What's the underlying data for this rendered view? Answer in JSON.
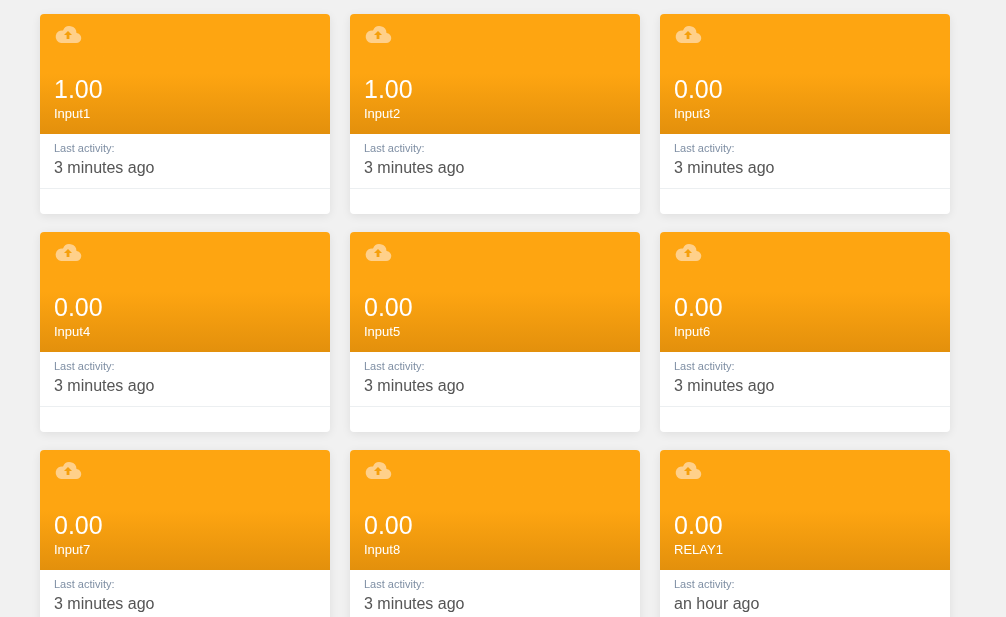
{
  "cards": [
    {
      "value": "1.00",
      "name": "Input1",
      "activity_label": "Last activity:",
      "activity": "3 minutes ago"
    },
    {
      "value": "1.00",
      "name": "Input2",
      "activity_label": "Last activity:",
      "activity": "3 minutes ago"
    },
    {
      "value": "0.00",
      "name": "Input3",
      "activity_label": "Last activity:",
      "activity": "3 minutes ago"
    },
    {
      "value": "0.00",
      "name": "Input4",
      "activity_label": "Last activity:",
      "activity": "3 minutes ago"
    },
    {
      "value": "0.00",
      "name": "Input5",
      "activity_label": "Last activity:",
      "activity": "3 minutes ago"
    },
    {
      "value": "0.00",
      "name": "Input6",
      "activity_label": "Last activity:",
      "activity": "3 minutes ago"
    },
    {
      "value": "0.00",
      "name": "Input7",
      "activity_label": "Last activity:",
      "activity": "3 minutes ago"
    },
    {
      "value": "0.00",
      "name": "Input8",
      "activity_label": "Last activity:",
      "activity": "3 minutes ago"
    },
    {
      "value": "0.00",
      "name": "RELAY1",
      "activity_label": "Last activity:",
      "activity": "an hour ago"
    }
  ]
}
